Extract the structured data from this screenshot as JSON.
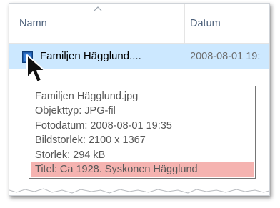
{
  "columns": {
    "name_label": "Namn",
    "date_label": "Datum"
  },
  "file": {
    "name": "Familjen Hägglund....",
    "date": "2008-08-01 19:",
    "icon": "image-file-icon"
  },
  "tooltip": {
    "lines": [
      "Familjen Hägglund.jpg",
      "Objekttyp: JPG-fil",
      "Fotodatum: 2008-08-01 19:35",
      "Bildstorlek: 2100 x 1367",
      "Storlek: 294 kB",
      "Titel: Ca 1928. Syskonen Hägglund"
    ]
  },
  "colors": {
    "selection": "#cce8ff",
    "highlight": "#f5b3b0",
    "header_text": "#4c607a"
  }
}
